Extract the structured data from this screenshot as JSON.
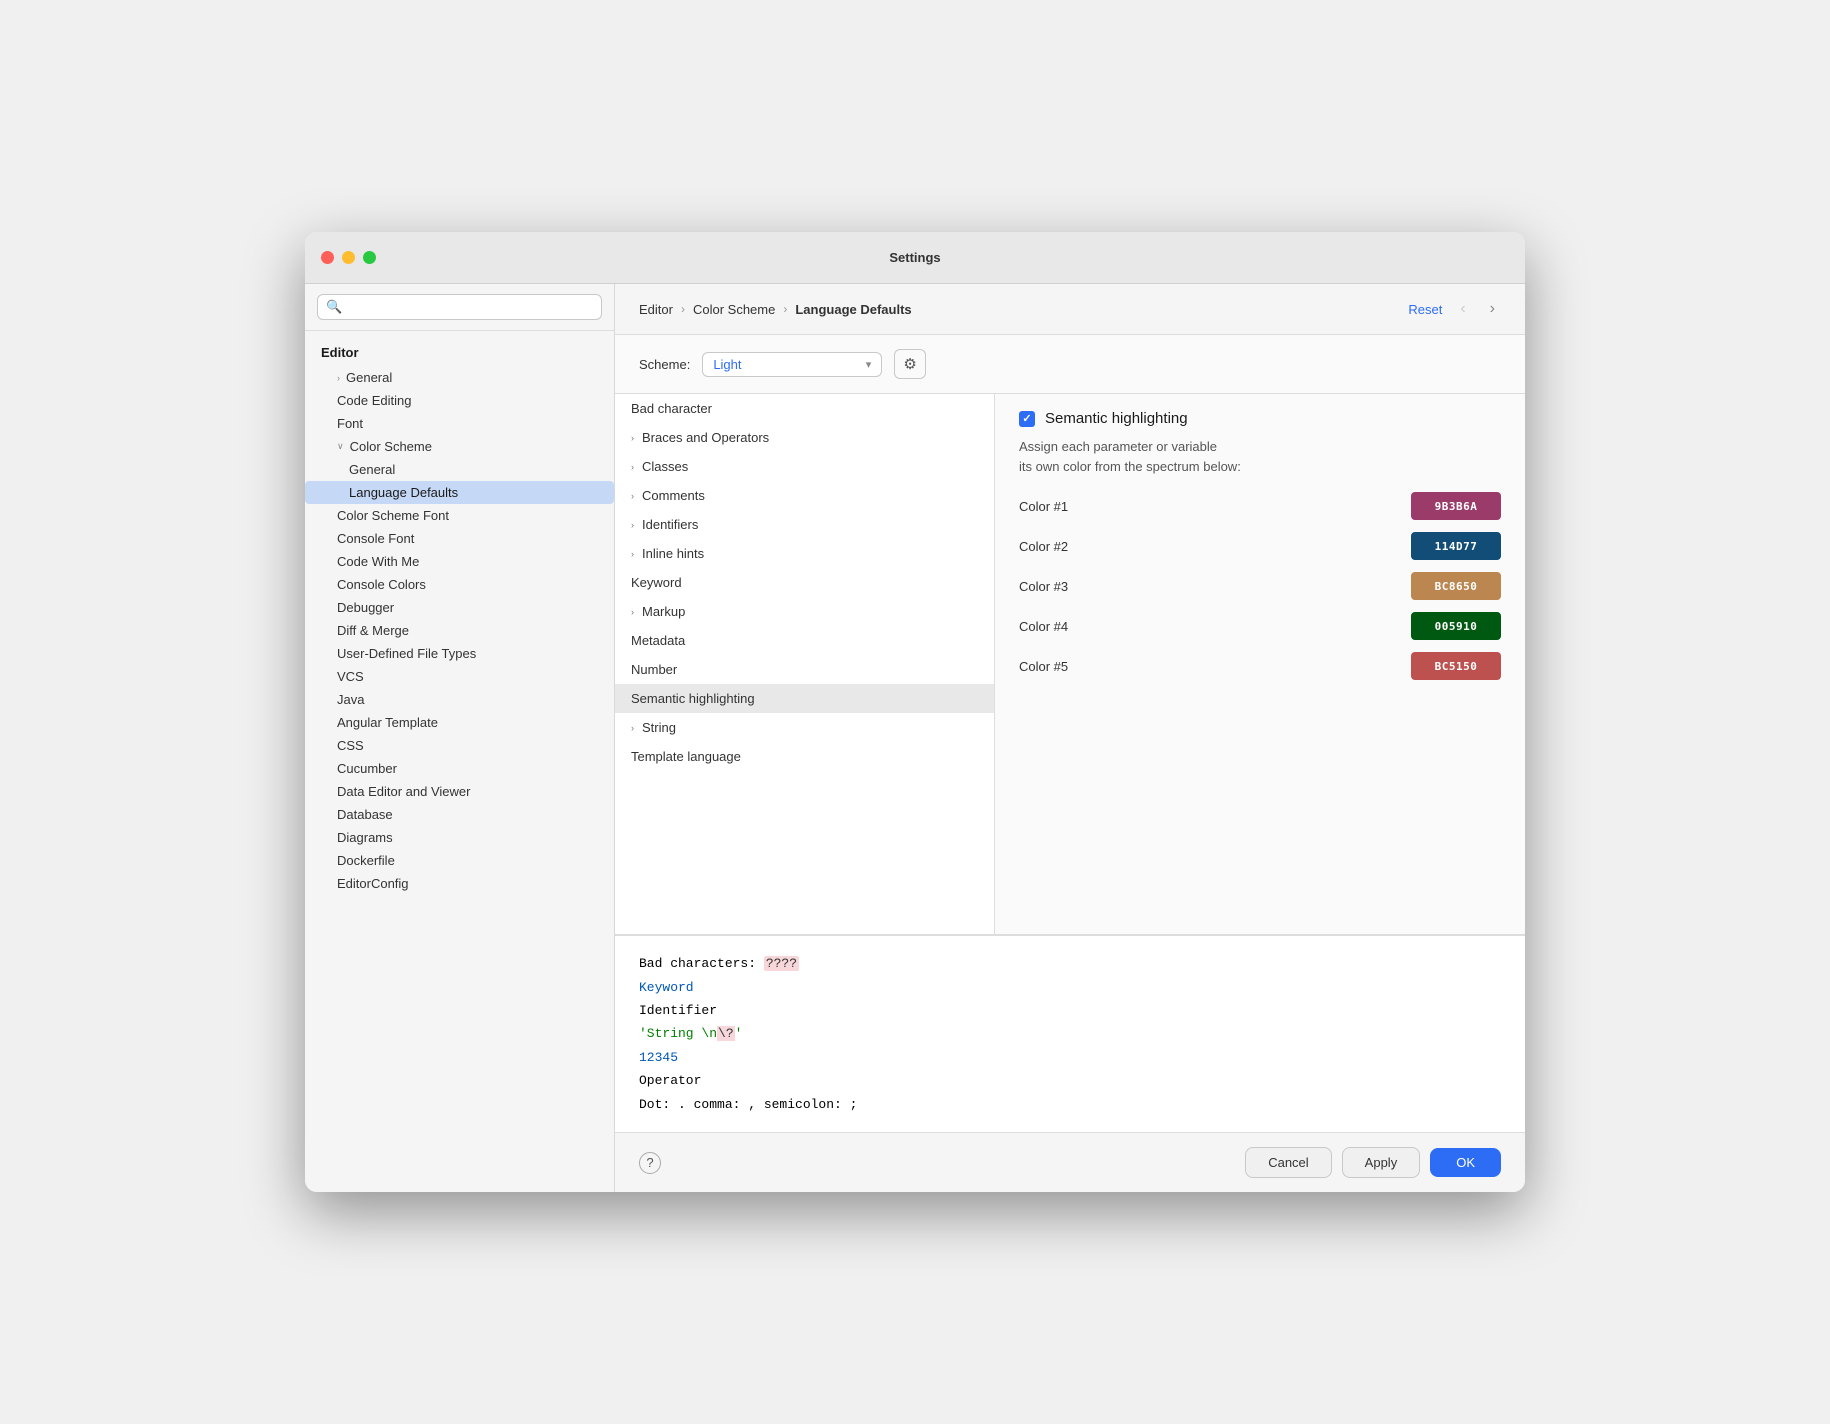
{
  "window": {
    "title": "Settings"
  },
  "sidebar": {
    "search_placeholder": "🔍",
    "section_header": "Editor",
    "items": [
      {
        "id": "general",
        "label": "General",
        "indent": 1,
        "chevron": "›",
        "active": false
      },
      {
        "id": "code-editing",
        "label": "Code Editing",
        "indent": 1,
        "chevron": "",
        "active": false
      },
      {
        "id": "font",
        "label": "Font",
        "indent": 1,
        "chevron": "",
        "active": false
      },
      {
        "id": "color-scheme",
        "label": "Color Scheme",
        "indent": 1,
        "chevron": "∨",
        "active": false
      },
      {
        "id": "cs-general",
        "label": "General",
        "indent": 2,
        "chevron": "",
        "active": false
      },
      {
        "id": "language-defaults",
        "label": "Language Defaults",
        "indent": 2,
        "chevron": "",
        "active": true
      },
      {
        "id": "color-scheme-font",
        "label": "Color Scheme Font",
        "indent": 1,
        "chevron": "",
        "active": false
      },
      {
        "id": "console-font",
        "label": "Console Font",
        "indent": 1,
        "chevron": "",
        "active": false
      },
      {
        "id": "code-with-me",
        "label": "Code With Me",
        "indent": 1,
        "chevron": "",
        "active": false
      },
      {
        "id": "console-colors",
        "label": "Console Colors",
        "indent": 1,
        "chevron": "",
        "active": false
      },
      {
        "id": "debugger",
        "label": "Debugger",
        "indent": 1,
        "chevron": "",
        "active": false
      },
      {
        "id": "diff-merge",
        "label": "Diff & Merge",
        "indent": 1,
        "chevron": "",
        "active": false
      },
      {
        "id": "user-defined",
        "label": "User-Defined File Types",
        "indent": 1,
        "chevron": "",
        "active": false
      },
      {
        "id": "vcs",
        "label": "VCS",
        "indent": 1,
        "chevron": "",
        "active": false
      },
      {
        "id": "java",
        "label": "Java",
        "indent": 1,
        "chevron": "",
        "active": false
      },
      {
        "id": "angular",
        "label": "Angular Template",
        "indent": 1,
        "chevron": "",
        "active": false
      },
      {
        "id": "css",
        "label": "CSS",
        "indent": 1,
        "chevron": "",
        "active": false
      },
      {
        "id": "cucumber",
        "label": "Cucumber",
        "indent": 1,
        "chevron": "",
        "active": false
      },
      {
        "id": "data-editor",
        "label": "Data Editor and Viewer",
        "indent": 1,
        "chevron": "",
        "active": false
      },
      {
        "id": "database",
        "label": "Database",
        "indent": 1,
        "chevron": "",
        "active": false
      },
      {
        "id": "diagrams",
        "label": "Diagrams",
        "indent": 1,
        "chevron": "",
        "active": false
      },
      {
        "id": "dockerfile",
        "label": "Dockerfile",
        "indent": 1,
        "chevron": "",
        "active": false
      },
      {
        "id": "editorconfig",
        "label": "EditorConfig",
        "indent": 1,
        "chevron": "",
        "active": false
      }
    ]
  },
  "header": {
    "breadcrumb": [
      "Editor",
      "Color Scheme",
      "Language Defaults"
    ],
    "reset_label": "Reset",
    "back_label": "‹",
    "forward_label": "›"
  },
  "scheme": {
    "label": "Scheme:",
    "value": "Light",
    "gear_icon": "⚙"
  },
  "list_items": [
    {
      "label": "Bad character",
      "hasChevron": false,
      "selected": false
    },
    {
      "label": "Braces and Operators",
      "hasChevron": true,
      "selected": false
    },
    {
      "label": "Classes",
      "hasChevron": true,
      "selected": false
    },
    {
      "label": "Comments",
      "hasChevron": true,
      "selected": false
    },
    {
      "label": "Identifiers",
      "hasChevron": true,
      "selected": false
    },
    {
      "label": "Inline hints",
      "hasChevron": true,
      "selected": false
    },
    {
      "label": "Keyword",
      "hasChevron": false,
      "selected": false
    },
    {
      "label": "Markup",
      "hasChevron": true,
      "selected": false
    },
    {
      "label": "Metadata",
      "hasChevron": false,
      "selected": false
    },
    {
      "label": "Number",
      "hasChevron": false,
      "selected": false
    },
    {
      "label": "Semantic highlighting",
      "hasChevron": false,
      "selected": true
    },
    {
      "label": "String",
      "hasChevron": true,
      "selected": false
    },
    {
      "label": "Template language",
      "hasChevron": false,
      "selected": false
    }
  ],
  "semantic": {
    "title": "Semantic highlighting",
    "checkbox_checked": true,
    "description": "Assign each parameter or variable\nits own color from the spectrum below:",
    "colors": [
      {
        "label": "Color #1",
        "hex": "9B3B6A",
        "bg": "#9B3B6A"
      },
      {
        "label": "Color #2",
        "hex": "114D77",
        "bg": "#114D77"
      },
      {
        "label": "Color #3",
        "hex": "BC8650",
        "bg": "#BC8650"
      },
      {
        "label": "Color #4",
        "hex": "005910",
        "bg": "#005910"
      },
      {
        "label": "Color #5",
        "hex": "BC5150",
        "bg": "#BC5150"
      }
    ]
  },
  "preview": {
    "lines": [
      {
        "type": "bad_chars",
        "text": "Bad characters: ",
        "highlight": "????"
      },
      {
        "type": "keyword",
        "text": "Keyword"
      },
      {
        "type": "normal",
        "text": "Identifier"
      },
      {
        "type": "string",
        "text": "'String \\n\\?'",
        "escape_positions": [
          9,
          11
        ]
      },
      {
        "type": "number",
        "text": "12345"
      },
      {
        "type": "normal",
        "text": "Operator"
      },
      {
        "type": "normal",
        "text": "Dot: . comma: , semicolon: ;"
      }
    ]
  },
  "buttons": {
    "cancel": "Cancel",
    "apply": "Apply",
    "ok": "OK",
    "help": "?"
  }
}
